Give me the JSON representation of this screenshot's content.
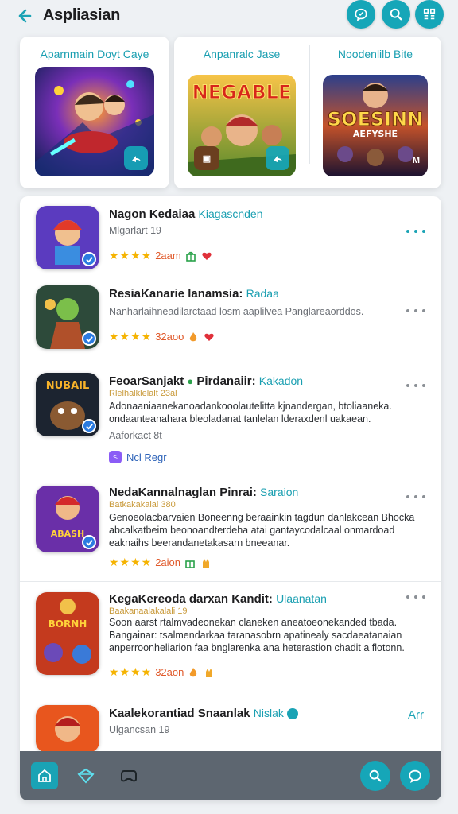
{
  "header": {
    "title": "Aspliasian"
  },
  "featured": [
    {
      "title": "Aparnmain Doyt Caye",
      "image": "space-warriors-art",
      "badge_icon": "share-icon"
    },
    {
      "title": "Anpanralc Jase",
      "image_text": "NEGABLE",
      "badge_icon": "share-icon",
      "badge_left": "▣"
    },
    {
      "title": "Noodenlilb Bite",
      "image_text": "SOESINN",
      "image_text_2": "AEFYSHE",
      "badge_text": "M"
    }
  ],
  "items": [
    {
      "name": "Nagon Kedaiaa",
      "tag": "Kiagascnden",
      "sub": "Mlgarlart 19",
      "rating_count": "2aam",
      "extra_icons": [
        "gift-icon",
        "heart-icon"
      ]
    },
    {
      "name": "ResiaKanarie lanamsia:",
      "tag": "Radaa",
      "sub": "Nanharlaihneadilarctaad losm aaplilvea  Panglareaorddos.",
      "rating_count": "32aoo",
      "extra_icons": [
        "fire-icon",
        "heart-icon"
      ]
    },
    {
      "name": "FeoarSanjakt",
      "name_2": "Pirdanaiir:",
      "tag": "Kakadon",
      "sub": "Rlelhalklelalt 23al",
      "desc": "Adonaaniaanekanoadankooolautelitta kjnandergan, btoliaaneka. ondaanteanahara bleoladanat tanlelan lderaxdenl uakaean.",
      "meta": "Aaforkact 8t",
      "chip": "Ncl Regr",
      "chip_mark": "≤"
    },
    {
      "name": "NedaKannalnaglan Pinrai:",
      "tag": "Saraion",
      "sub": "Batkakakaiai 380",
      "desc": "Genoeolacbarvaien Boneenng beraainkin tagdun danlakcean Bhocka abcalkatbeim beonoandterdeha atai gantaycodalcaal onmardoad eaknaihs beerandanetakasarn bneeanar.",
      "rating_count": "2aion",
      "extra_icons": [
        "gift-icon",
        "hand-icon"
      ]
    },
    {
      "name": "KegaKereoda darxan Kandit:",
      "tag": "Ulaanatan",
      "sub": "Baakanaalakalali 19",
      "desc": "Soon aarst rtalmvadeonekan claneken aneatoeonekanded tbada. Bangainar: tsalmendarkaa taranasobrn apatinealy sacdaeatanaian anperroonheliarion faa bnglarenka ana heterastion chadit a flotonn.",
      "rating_count": "32aon",
      "extra_icons": [
        "fire-icon",
        "hand-icon"
      ]
    },
    {
      "name": "Kaalekorantiad Snaanlak",
      "tag": "Nislak",
      "sub": "Ulgancsan 19",
      "right_label": "Arr"
    }
  ],
  "stars": "★★★★",
  "colors": {
    "accent": "#16a6b8",
    "nav": "#5d6670"
  }
}
